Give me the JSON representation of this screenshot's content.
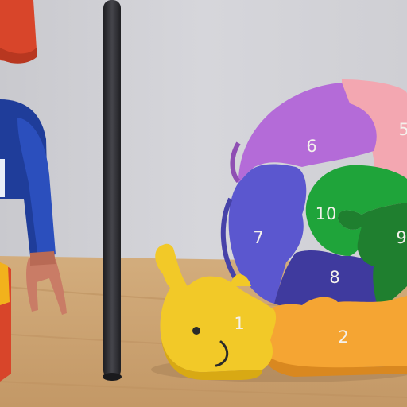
{
  "scene": {
    "subject": "wooden snail number puzzle beside a toy figure",
    "colors": {
      "wall": "#cfcfd3",
      "shelf": "#cfa877",
      "pole": "#2f2f33",
      "figure_blue": "#1f3d9a",
      "figure_red": "#d8452a",
      "figure_hand": "#c97c66"
    }
  },
  "puzzle": {
    "pieces": [
      {
        "label": "1",
        "color": "#f2c928"
      },
      {
        "label": "2",
        "color": "#f5a533"
      },
      {
        "label": "5",
        "color": "#f3a7b1"
      },
      {
        "label": "6",
        "color": "#b46bd8"
      },
      {
        "label": "7",
        "color": "#5b57cf"
      },
      {
        "label": "8",
        "color": "#3f3a9e"
      },
      {
        "label": "9",
        "color": "#1f7f2f"
      },
      {
        "label": "10",
        "color": "#1fa43a"
      }
    ]
  }
}
